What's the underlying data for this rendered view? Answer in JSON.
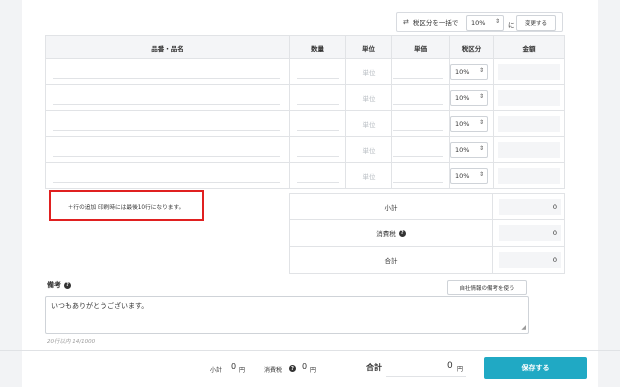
{
  "bulk_tax": {
    "icon": "swap-arrows-icon",
    "label": "税区分を一括で",
    "value": "10%",
    "suffix": "に",
    "button": "変更する"
  },
  "table": {
    "headers": [
      "品番・品名",
      "数量",
      "単位",
      "単価",
      "税区分",
      "金額"
    ],
    "rows": [
      {
        "unit": "単位",
        "tax": "10%"
      },
      {
        "unit": "単位",
        "tax": "10%"
      },
      {
        "unit": "単位",
        "tax": "10%"
      },
      {
        "unit": "単位",
        "tax": "10%"
      },
      {
        "unit": "単位",
        "tax": "10%"
      }
    ],
    "add_row": "＋行の追加 印刷時には最後10行になります。"
  },
  "totals": [
    {
      "label": "小計",
      "value": "0"
    },
    {
      "label": "消費税",
      "value": "0",
      "help": true
    },
    {
      "label": "合計",
      "value": "0"
    }
  ],
  "notes": {
    "label": "備考",
    "own_button": "自社情報の備考を使う",
    "text": "いつもありがとうございます。",
    "counter": "20行以内 14/1000"
  },
  "footer": {
    "subtotal_label": "小計",
    "subtotal_value": "0",
    "subtotal_unit": "円",
    "tax_label": "消費税",
    "tax_value": "0",
    "tax_unit": "円",
    "total_label": "合計",
    "total_value": "0",
    "total_unit": "円",
    "save": "保存する"
  },
  "colors": {
    "accent": "#20a9c4",
    "highlight": "#e02020"
  }
}
